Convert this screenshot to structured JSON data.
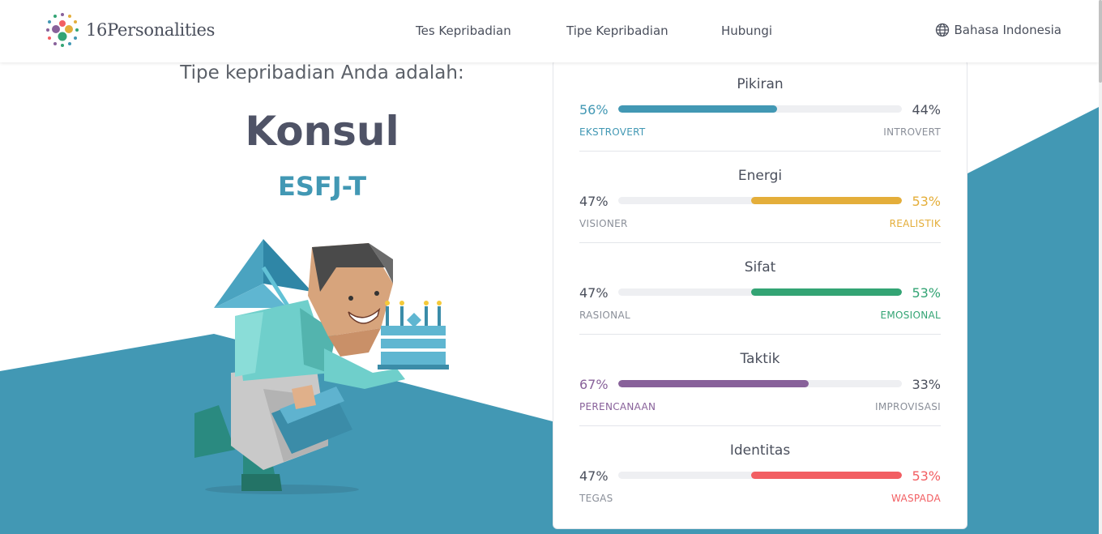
{
  "brand": {
    "name": "16Personalities"
  },
  "nav": {
    "items": [
      "Tes Kepribadian",
      "Tipe Kepribadian",
      "Hubungi"
    ]
  },
  "language": {
    "label": "Bahasa Indonesia"
  },
  "result": {
    "intro": "Tipe kepribadian Anda adalah:",
    "type_name": "Konsul",
    "type_code": "ESFJ-T"
  },
  "colors": {
    "background_band": "#4298b4",
    "pikiran": "#4298b4",
    "energi": "#e4ae3a",
    "sifat": "#33a474",
    "taktik": "#88619a",
    "identitas": "#f25e62"
  },
  "traits": [
    {
      "title": "Pikiran",
      "left_pct": "56%",
      "right_pct": "44%",
      "left_label": "EKSTROVERT",
      "right_label": "INTROVERT",
      "dominant": "left",
      "value": 0.56,
      "color": "#4298b4"
    },
    {
      "title": "Energi",
      "left_pct": "47%",
      "right_pct": "53%",
      "left_label": "VISIONER",
      "right_label": "REALISTIK",
      "dominant": "right",
      "value": 0.53,
      "color": "#e4ae3a"
    },
    {
      "title": "Sifat",
      "left_pct": "47%",
      "right_pct": "53%",
      "left_label": "RASIONAL",
      "right_label": "EMOSIONAL",
      "dominant": "right",
      "value": 0.53,
      "color": "#33a474"
    },
    {
      "title": "Taktik",
      "left_pct": "67%",
      "right_pct": "33%",
      "left_label": "PERENCANAAN",
      "right_label": "IMPROVISASI",
      "dominant": "left",
      "value": 0.67,
      "color": "#88619a"
    },
    {
      "title": "Identitas",
      "left_pct": "47%",
      "right_pct": "53%",
      "left_label": "TEGAS",
      "right_label": "WASPADA",
      "dominant": "right",
      "value": 0.53,
      "color": "#f25e62"
    }
  ]
}
